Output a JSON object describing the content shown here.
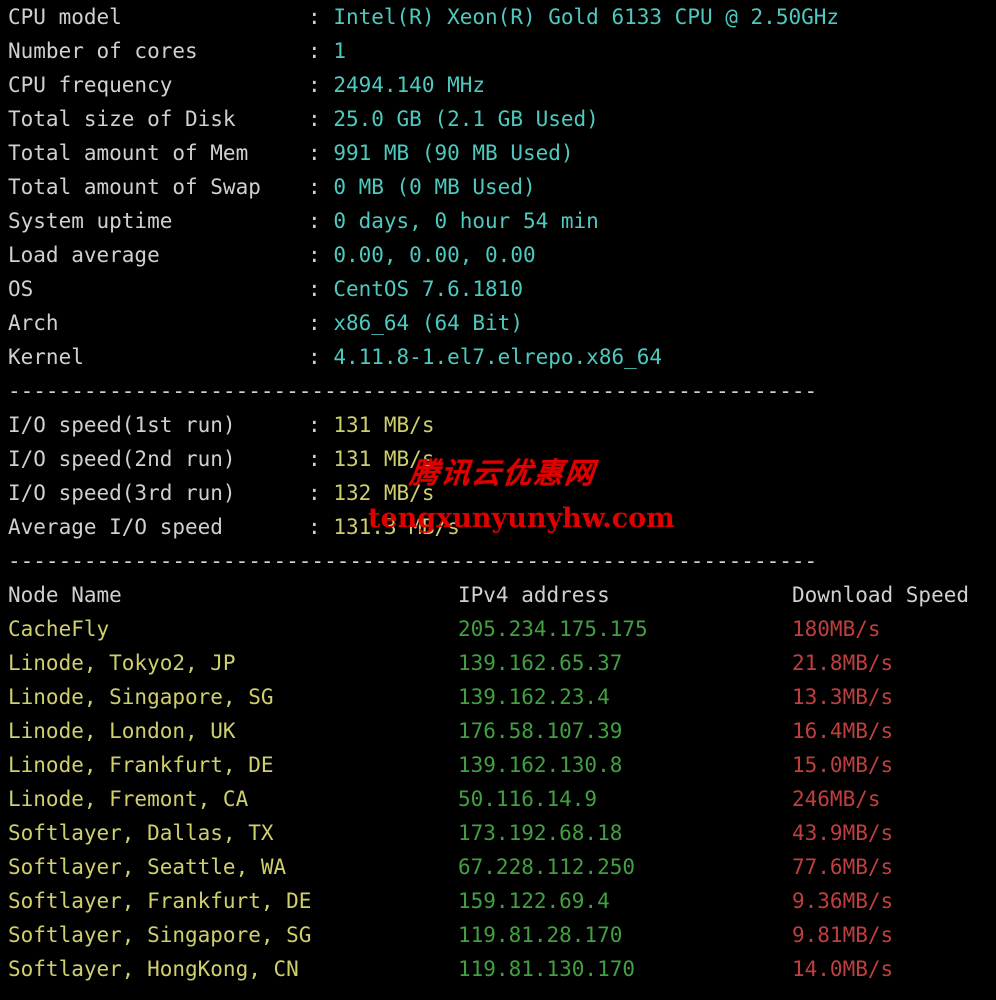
{
  "terminal": {
    "background_color": "#000000",
    "label_color": "#d0d0d0",
    "value_color": "#4ec9bf",
    "io_value_color": "#cfcf6e",
    "node_name_color": "#cfcf6e",
    "ip_color": "#42a042",
    "speed_color": "#bf3f3f",
    "separator": ":",
    "divider": "----------------------------------------------------------------"
  },
  "system_info": {
    "rows": [
      {
        "label": "CPU model",
        "value": "Intel(R) Xeon(R) Gold 6133 CPU @ 2.50GHz"
      },
      {
        "label": "Number of cores",
        "value": "1"
      },
      {
        "label": "CPU frequency",
        "value": "2494.140 MHz"
      },
      {
        "label": "Total size of Disk",
        "value": "25.0 GB (2.1 GB Used)"
      },
      {
        "label": "Total amount of Mem",
        "value": "991 MB (90 MB Used)"
      },
      {
        "label": "Total amount of Swap",
        "value": "0 MB (0 MB Used)"
      },
      {
        "label": "System uptime",
        "value": "0 days, 0 hour 54 min"
      },
      {
        "label": "Load average",
        "value": "0.00, 0.00, 0.00"
      },
      {
        "label": "OS",
        "value": "CentOS 7.6.1810"
      },
      {
        "label": "Arch",
        "value": "x86_64 (64 Bit)"
      },
      {
        "label": "Kernel",
        "value": "4.11.8-1.el7.elrepo.x86_64"
      }
    ]
  },
  "io_speed": {
    "rows": [
      {
        "label": "I/O speed(1st run)",
        "value": "131 MB/s"
      },
      {
        "label": "I/O speed(2nd run)",
        "value": "131 MB/s"
      },
      {
        "label": "I/O speed(3rd run)",
        "value": "132 MB/s"
      },
      {
        "label": "Average I/O speed",
        "value": "131.3 MB/s"
      }
    ]
  },
  "node_table": {
    "headers": {
      "node_name": "Node Name",
      "ipv4": "IPv4 address",
      "download_speed": "Download Speed"
    },
    "rows": [
      {
        "node": "CacheFly",
        "ip": "205.234.175.175",
        "speed": "180MB/s"
      },
      {
        "node": "Linode, Tokyo2, JP",
        "ip": "139.162.65.37",
        "speed": "21.8MB/s"
      },
      {
        "node": "Linode, Singapore, SG",
        "ip": "139.162.23.4",
        "speed": "13.3MB/s"
      },
      {
        "node": "Linode, London, UK",
        "ip": "176.58.107.39",
        "speed": "16.4MB/s"
      },
      {
        "node": "Linode, Frankfurt, DE",
        "ip": "139.162.130.8",
        "speed": "15.0MB/s"
      },
      {
        "node": "Linode, Fremont, CA",
        "ip": "50.116.14.9",
        "speed": "246MB/s"
      },
      {
        "node": "Softlayer, Dallas, TX",
        "ip": "173.192.68.18",
        "speed": "43.9MB/s"
      },
      {
        "node": "Softlayer, Seattle, WA",
        "ip": "67.228.112.250",
        "speed": "77.6MB/s"
      },
      {
        "node": "Softlayer, Frankfurt, DE",
        "ip": "159.122.69.4",
        "speed": "9.36MB/s"
      },
      {
        "node": "Softlayer, Singapore, SG",
        "ip": "119.81.28.170",
        "speed": "9.81MB/s"
      },
      {
        "node": "Softlayer, HongKong, CN",
        "ip": "119.81.130.170",
        "speed": "14.0MB/s"
      }
    ]
  },
  "watermark": {
    "chinese_text": "腾讯云优惠网",
    "domain_text": "tengxunyunyhw.com",
    "color": "#e00000"
  }
}
